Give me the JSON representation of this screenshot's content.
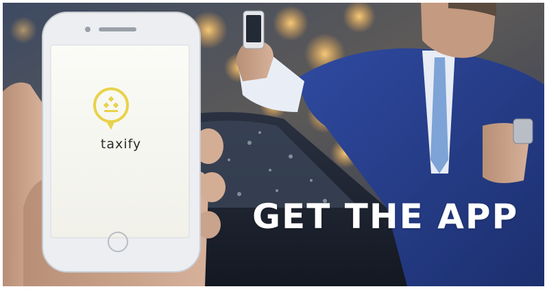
{
  "banner": {
    "headline": "GET THE APP",
    "brand_name": "taxify",
    "logo_color": "#e8d24a",
    "headline_color": "#ffffff"
  }
}
